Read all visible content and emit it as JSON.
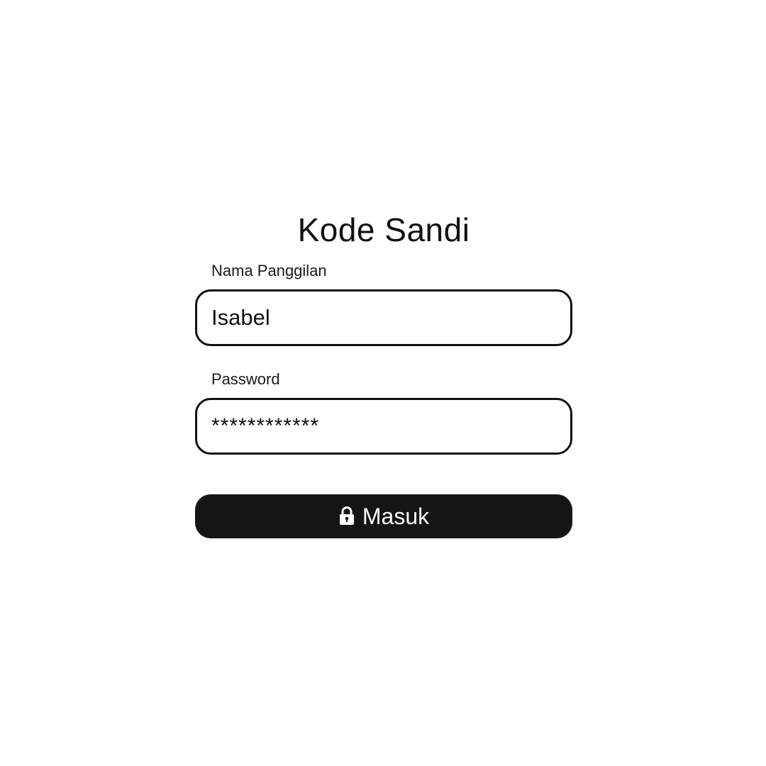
{
  "title": "Kode Sandi",
  "fields": {
    "nickname": {
      "label": "Nama Panggilan",
      "value": "Isabel",
      "placeholder": ""
    },
    "password": {
      "label": "Password",
      "value": "************",
      "placeholder": ""
    }
  },
  "submit": {
    "label": "Masuk",
    "icon": "lock-icon"
  },
  "colors": {
    "text": "#111111",
    "button_bg": "#151515",
    "button_text": "#ffffff",
    "border": "#111111",
    "background": "#ffffff"
  }
}
